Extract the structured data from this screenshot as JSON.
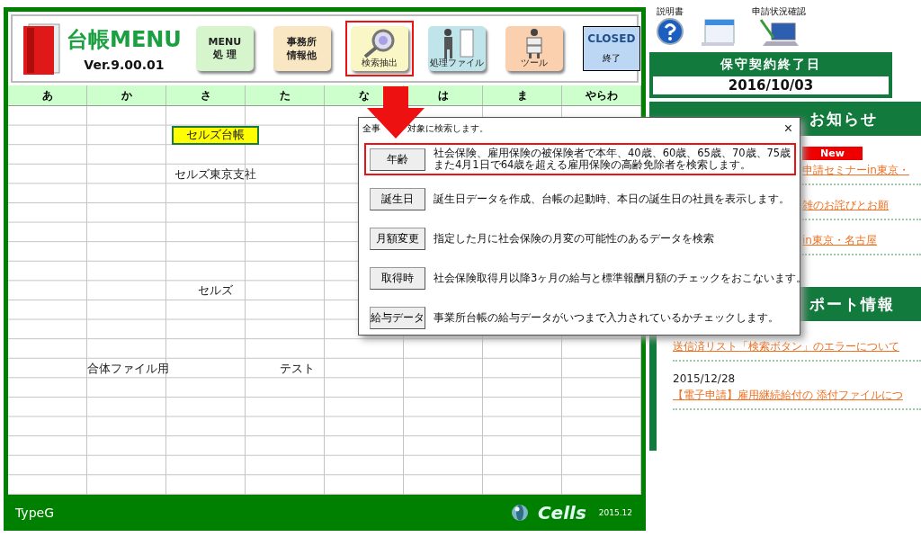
{
  "app_header": {
    "logo_title": "台帳MENU",
    "version": "Ver.9.00.01",
    "buttons": [
      {
        "kind": "text",
        "lines": [
          "MENU",
          "処 理"
        ],
        "color": "#d6f5cc",
        "highlighted": false
      },
      {
        "kind": "text",
        "lines": [
          "事務所",
          "情報他"
        ],
        "color": "#f9e6c3",
        "highlighted": false
      },
      {
        "kind": "search",
        "lines": [
          "検索抽出"
        ],
        "color": "#faf6c6",
        "highlighted": true
      },
      {
        "kind": "files",
        "lines": [
          "処理ファイル"
        ],
        "color": "#bfe4ea",
        "highlighted": false
      },
      {
        "kind": "tool",
        "lines": [
          "ツール"
        ],
        "color": "#fad0ae",
        "highlighted": false
      },
      {
        "kind": "close",
        "lines": [
          "CLOSED",
          "終了"
        ],
        "color": "#bcd7f3",
        "highlighted": false
      }
    ]
  },
  "kana_tabs": [
    "あ",
    "か",
    "さ",
    "た",
    "な",
    "は",
    "ま",
    "やらわ"
  ],
  "grid": {
    "rows": [
      [
        null,
        null,
        null,
        null,
        null,
        null,
        null,
        null
      ],
      [
        null,
        null,
        {
          "text": "セルズ台帳",
          "selected": true
        },
        null,
        null,
        null,
        null,
        null
      ],
      [
        null,
        null,
        null,
        null,
        null,
        null,
        null,
        null
      ],
      [
        null,
        null,
        {
          "text": "セルズ東京支社",
          "selected": false
        },
        null,
        null,
        null,
        null,
        null
      ],
      [
        null,
        null,
        null,
        null,
        null,
        null,
        null,
        null
      ],
      [
        null,
        null,
        null,
        null,
        null,
        null,
        null,
        null
      ],
      [
        null,
        null,
        null,
        null,
        null,
        null,
        null,
        null
      ],
      [
        null,
        null,
        null,
        null,
        null,
        null,
        null,
        null
      ],
      [
        null,
        null,
        null,
        null,
        null,
        null,
        null,
        null
      ],
      [
        null,
        null,
        {
          "text": "セルズ",
          "selected": false
        },
        null,
        null,
        null,
        null,
        null
      ],
      [
        null,
        null,
        null,
        null,
        null,
        null,
        null,
        null
      ],
      [
        null,
        null,
        null,
        null,
        null,
        null,
        null,
        null
      ],
      [
        null,
        null,
        null,
        null,
        null,
        null,
        null,
        null
      ],
      [
        null,
        {
          "text": "合体ファイル用",
          "selected": false
        },
        null,
        {
          "text": "テスト",
          "selected": false
        },
        null,
        null,
        null,
        null
      ],
      [
        null,
        null,
        null,
        null,
        null,
        null,
        null,
        null
      ],
      [
        null,
        null,
        null,
        null,
        null,
        null,
        null,
        null
      ],
      [
        null,
        null,
        null,
        null,
        null,
        null,
        null,
        null
      ],
      [
        null,
        null,
        null,
        null,
        null,
        null,
        null,
        null
      ],
      [
        null,
        null,
        null,
        null,
        null,
        null,
        null,
        null
      ],
      [
        null,
        null,
        null,
        null,
        null,
        null,
        null,
        null
      ]
    ]
  },
  "footer": {
    "type": "TypeG",
    "brand": "Cells",
    "date": "2015.12"
  },
  "top_links": [
    {
      "kind": "manual",
      "label": "説明書"
    },
    {
      "kind": "calendar"
    },
    {
      "kind": "status",
      "label": "申請状況確認"
    }
  ],
  "contract": {
    "title": "保守契約終了日",
    "date": "2016/10/03"
  },
  "news_sections": [
    {
      "title": "お知らせ",
      "items": [
        {
          "badge": "New",
          "text": "申請セミナーin東京・"
        },
        {
          "text": "雑のお詫びとお願"
        },
        {
          "text": "in東京・名古屋"
        }
      ]
    },
    {
      "title": "ポート情報",
      "items": [
        {
          "text": "送信済リスト「検索ボタン」のエラーについて"
        },
        {
          "date": "2015/12/28",
          "text": "【電子申請】雇用継続給付の 添付ファイルにつ"
        }
      ]
    }
  ],
  "dialog": {
    "title_parts": [
      "全事",
      "対象に検索します。"
    ],
    "close": "×",
    "rows": [
      {
        "button": "年齢",
        "lines": [
          "社会保険、雇用保険の被保険者で本年、40歳、60歳、65歳、70歳、75歳",
          "また4月1日で64歳を超える雇用保険の高齢免除者を検索します。"
        ],
        "highlighted": true
      },
      {
        "button": "誕生日",
        "lines": [
          "誕生日データを作成、台帳の起動時、本日の誕生日の社員を表示します。"
        ],
        "highlighted": false
      },
      {
        "button": "月額変更",
        "lines": [
          "指定した月に社会保険の月変の可能性のあるデータを検索"
        ],
        "highlighted": false
      },
      {
        "button": "取得時",
        "lines": [
          "社会保険取得月以降3ヶ月の給与と標準報酬月額のチェックをおこないます。"
        ],
        "highlighted": false
      },
      {
        "button": "給与データ",
        "lines": [
          "事業所台帳の給与データがいつまで入力されているかチェックします。"
        ],
        "highlighted": false
      }
    ]
  }
}
